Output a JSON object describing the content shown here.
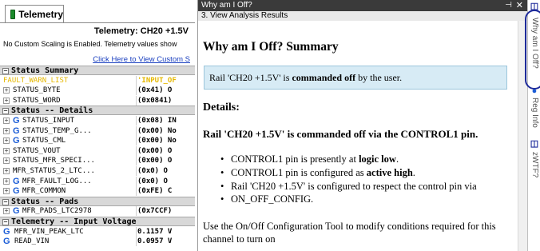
{
  "left_panel": {
    "tab_label": "Telemetry",
    "title_label": "Telemetry: ",
    "title_value": "CH20 +1.5V",
    "scaling_note": "No Custom Scaling is Enabled.  Telemetry values show",
    "custom_link": "Click Here to View Custom S",
    "rows": [
      {
        "kind": "header",
        "text": "Status Summary"
      },
      {
        "kind": "warn",
        "name": "FAULT_WARN_LIST",
        "value": "'INPUT_OF"
      },
      {
        "kind": "item",
        "icon": false,
        "name": "STATUS_BYTE",
        "value": "(0x41) O"
      },
      {
        "kind": "item",
        "icon": false,
        "name": "STATUS_WORD",
        "value": "(0x0841)"
      },
      {
        "kind": "header",
        "text": "Status -- Details"
      },
      {
        "kind": "item",
        "icon": true,
        "name": "STATUS_INPUT",
        "value": "(0x08) IN"
      },
      {
        "kind": "item",
        "icon": true,
        "name": "STATUS_TEMP_G...",
        "value": "(0x00) No"
      },
      {
        "kind": "item",
        "icon": true,
        "name": "STATUS_CML",
        "value": "(0x00) No"
      },
      {
        "kind": "item",
        "icon": false,
        "name": "STATUS_VOUT",
        "value": "(0x00) O"
      },
      {
        "kind": "item",
        "icon": false,
        "name": "STATUS_MFR_SPECI...",
        "value": "(0x00) O"
      },
      {
        "kind": "item",
        "icon": false,
        "name": "MFR_STATUS_2_LTC...",
        "value": "(0x0) O"
      },
      {
        "kind": "item",
        "icon": true,
        "name": "MFR_FAULT_LOG...",
        "value": "(0x0) O"
      },
      {
        "kind": "item",
        "icon": true,
        "name": "MFR_COMMON",
        "value": "(0xFE) C"
      },
      {
        "kind": "header",
        "text": "Status -- Pads"
      },
      {
        "kind": "item",
        "icon": true,
        "name": "MFR_PADS_LTC2978",
        "value": "(0x7CCF)"
      },
      {
        "kind": "header",
        "text": "Telemetry -- Input Voltage"
      },
      {
        "kind": "item",
        "icon": true,
        "noexp": true,
        "name": "MFR_VIN_PEAK_LTC",
        "value": "0.1157 V"
      },
      {
        "kind": "item",
        "icon": true,
        "noexp": true,
        "name": "READ_VIN",
        "value": "0.0957 V"
      }
    ]
  },
  "panel": {
    "window_title": "Why am I Off?",
    "pin_glyph": "⊣",
    "close_glyph": "✕",
    "subtitle": "3. View Analysis Results",
    "heading": "Why am I Off? Summary",
    "summary_prefix": "Rail 'CH20 +1.5V' is ",
    "summary_bold": "commanded off",
    "summary_suffix": " by the user.",
    "details_heading": "Details:",
    "details_line": "Rail 'CH20 +1.5V' is commanded off via the CONTROL1 pin.",
    "bullets": [
      {
        "prefix": "CONTROL1 pin is presently at ",
        "bold": "logic low",
        "suffix": "."
      },
      {
        "prefix": "CONTROL1 pin is configured as ",
        "bold": "active high",
        "suffix": "."
      },
      {
        "prefix": "Rail 'CH20 +1.5V' is configured to respect the control pin via",
        "bold": "",
        "suffix": ""
      },
      {
        "prefix": "ON_OFF_CONFIG.",
        "bold": "",
        "suffix": ""
      }
    ],
    "footer": "Use the On/Off Configuration Tool to modify conditions required for this channel to turn on"
  },
  "sidebar": {
    "tab1": "Why am I Off?",
    "tab2": "Reg Info",
    "tab3": "zWTF?"
  },
  "colors": {
    "accent": "#1a5cd6",
    "warn": "#e6b800",
    "highlight_box": "#d7ebf5",
    "circle": "#1d2a9a"
  }
}
